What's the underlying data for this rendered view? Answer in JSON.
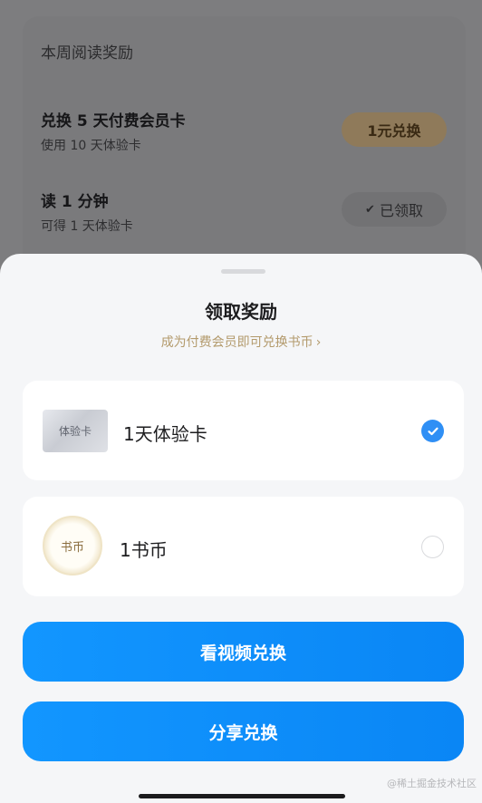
{
  "background": {
    "section_title": "本周阅读奖励",
    "tasks": [
      {
        "title": "兑换 5 天付费会员卡",
        "subtitle": "使用 10 天体验卡",
        "action_label": "1元兑换"
      },
      {
        "title": "读 1 分钟",
        "subtitle": "可得 1 天体验卡",
        "action_label": "已领取",
        "action_icon": "check-icon"
      }
    ]
  },
  "sheet": {
    "title": "领取奖励",
    "member_link": "成为付费会员即可兑换书币",
    "options": [
      {
        "thumb_text": "体验卡",
        "label": "1天体验卡",
        "selected": true
      },
      {
        "thumb_text": "书币",
        "label": "1书币",
        "selected": false
      }
    ],
    "buttons": {
      "watch_video": "看视频兑换",
      "share": "分享兑换"
    },
    "watermark": "@稀土掘金技术社区"
  },
  "colors": {
    "accent_blue": "#0a86f5",
    "gold_text": "#b39a6c",
    "sheet_bg": "#f5f6f8"
  }
}
